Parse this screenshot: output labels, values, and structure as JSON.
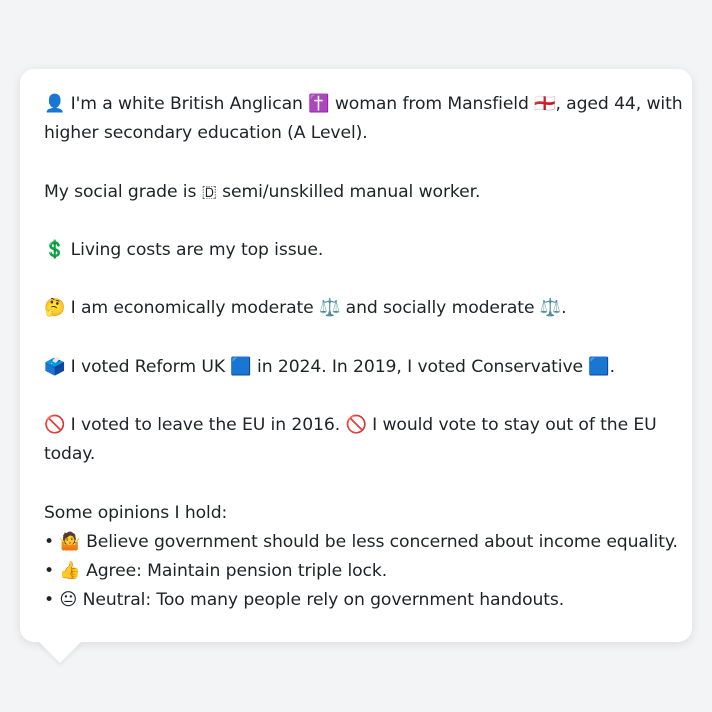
{
  "bubble": {
    "identity_line1": "👤 I'm a white British Anglican ✝️ woman from Mansfield 🏴󠁧󠁢󠁥󠁮󠁧󠁿, aged 44, with",
    "identity_line2": "higher secondary education (A Level).",
    "social_grade": "My social grade is 🇩 semi/unskilled manual worker.",
    "top_issue": "💲 Living costs are my top issue.",
    "ideology": "🤔 I am economically moderate ⚖️ and socially moderate ⚖️.",
    "votes": "🗳️ I voted Reform UK 🟦 in 2024. In 2019, I voted Conservative 🟦.",
    "brexit_line1": "🚫 I voted to leave the EU in 2016. 🚫 I would vote to stay out of the EU",
    "brexit_line2": "today.",
    "opinions_heading": "Some opinions I hold:",
    "opinions": [
      "• 🤷 Believe government should be less concerned about income equality.",
      "• 👍 Agree: Maintain pension triple lock.",
      "• 😐 Neutral: Too many people rely on government handouts."
    ]
  }
}
